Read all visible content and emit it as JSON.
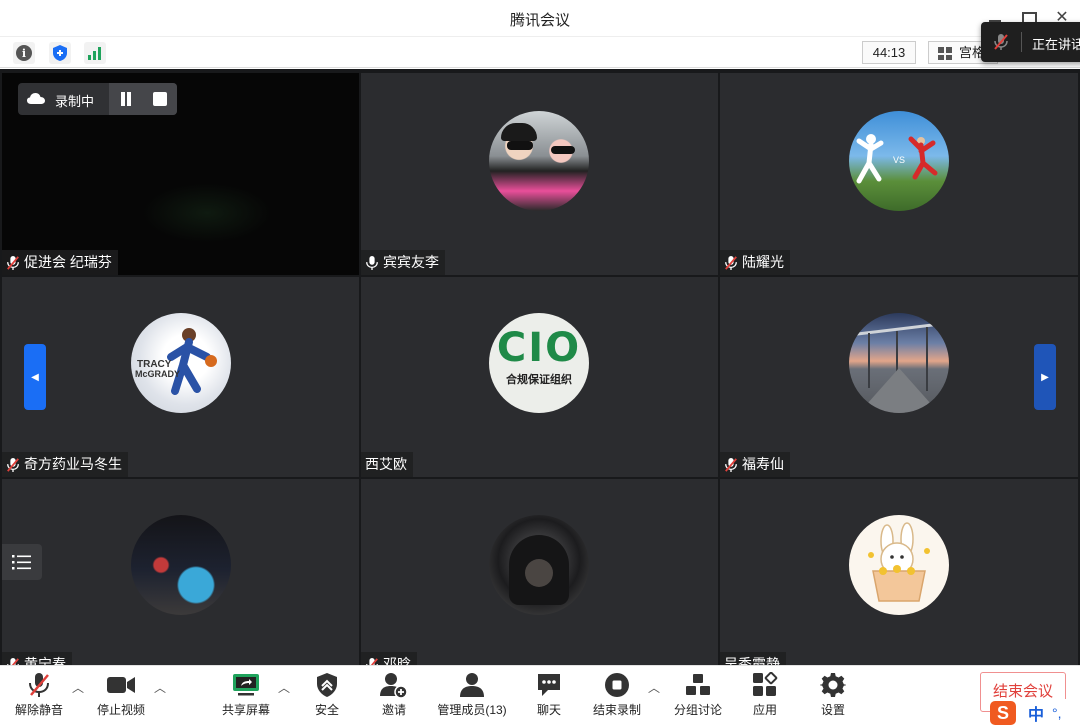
{
  "window": {
    "title": "腾讯会议"
  },
  "infobar": {
    "timer": "44:13",
    "layout_label": "宫格"
  },
  "speaking_popup": {
    "text": "正在讲话"
  },
  "recording": {
    "label": "录制中"
  },
  "participants": [
    {
      "name": "促进会 纪瑞芬",
      "muted": true,
      "avatar": "none-black-video"
    },
    {
      "name": "宾宾友李",
      "muted": false,
      "avatar": "selfie-two-people"
    },
    {
      "name": "陆耀光",
      "muted": true,
      "avatar": "jumpman-logo-photo"
    },
    {
      "name": "奇方药业马冬生",
      "muted": true,
      "avatar": "basketball-player"
    },
    {
      "name": "西艾欧",
      "muted": null,
      "avatar": "cio-logo",
      "avatar_text": "CIO",
      "avatar_subtext": "合规保证组织"
    },
    {
      "name": "福寿仙",
      "muted": true,
      "avatar": "dusk-street"
    },
    {
      "name": "黄宁春",
      "muted": true,
      "avatar": "night-city"
    },
    {
      "name": "邓晗",
      "muted": true,
      "avatar": "hooded-person"
    },
    {
      "name": "吴秀霞静",
      "muted": null,
      "avatar": "cartoon-bunny"
    }
  ],
  "toolbar": {
    "unmute": "解除静音",
    "stop_video": "停止视频",
    "share_screen": "共享屏幕",
    "security": "安全",
    "invite": "邀请",
    "manage_members": "管理成员(13)",
    "chat": "聊天",
    "end_recording": "结束录制",
    "breakout": "分组讨论",
    "apps": "应用",
    "settings": "设置",
    "end_meeting": "结束会议"
  },
  "ime": {
    "logo": "S",
    "mode": "中",
    "punct": "°,"
  },
  "colors": {
    "accent_blue": "#1a6ef5",
    "end_red": "#e0403b",
    "tile_bg": "#2b2c2f",
    "share_green": "#1fa35c"
  }
}
